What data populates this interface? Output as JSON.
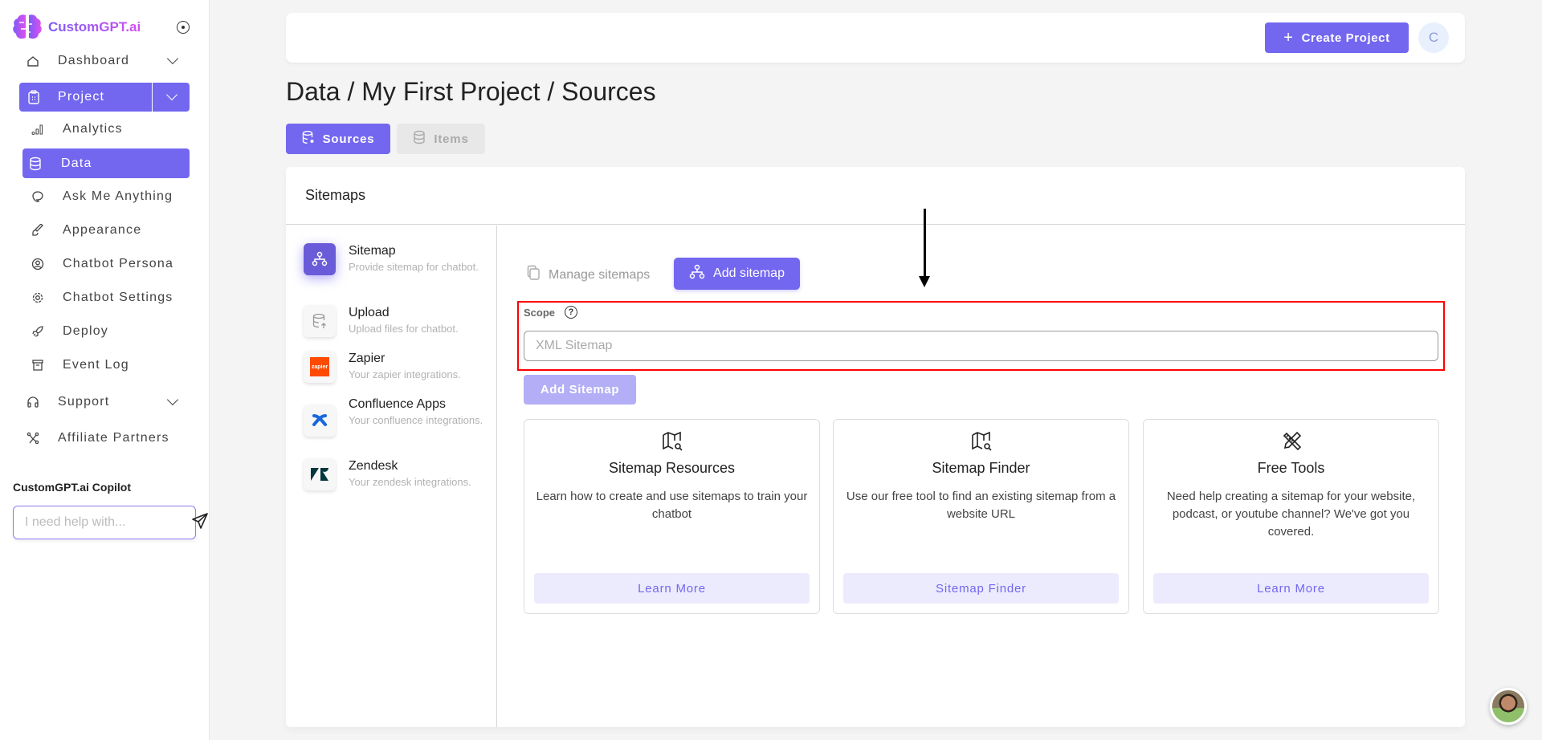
{
  "sidebar": {
    "brand": "CustomGPT.ai",
    "items": {
      "dashboard": "Dashboard",
      "project": "Project",
      "analytics": "Analytics",
      "data": "Data",
      "ask": "Ask Me Anything",
      "appearance": "Appearance",
      "persona": "Chatbot Persona",
      "settings": "Chatbot Settings",
      "deploy": "Deploy",
      "eventlog": "Event Log",
      "support": "Support",
      "affiliate": "Affiliate Partners"
    },
    "copilot": {
      "title": "CustomGPT.ai Copilot",
      "placeholder": "I need help with..."
    }
  },
  "header": {
    "create_project": "Create Project",
    "avatar_initial": "C"
  },
  "page": {
    "title": "Data / My First Project / Sources",
    "tabs": {
      "sources": "Sources",
      "items": "Items"
    }
  },
  "panel": {
    "title": "Sitemaps",
    "sources": [
      {
        "name": "Sitemap",
        "desc": "Provide sitemap for chatbot."
      },
      {
        "name": "Upload",
        "desc": "Upload files for chatbot."
      },
      {
        "name": "Zapier",
        "desc": "Your zapier integrations."
      },
      {
        "name": "Confluence Apps",
        "desc": "Your confluence integrations."
      },
      {
        "name": "Zendesk",
        "desc": "Your zendesk integrations."
      }
    ],
    "zapier_logo_text": "zapier",
    "manage_sitemaps": "Manage sitemaps",
    "add_sitemap_tab": "Add sitemap",
    "scope_label": "Scope",
    "help_glyph": "?",
    "input_placeholder": "XML Sitemap",
    "input_value": "",
    "add_sitemap_button": "Add Sitemap",
    "cards": [
      {
        "title": "Sitemap Resources",
        "desc": "Learn how to create and use sitemaps to train your chatbot",
        "button": "Learn More"
      },
      {
        "title": "Sitemap Finder",
        "desc": "Use our free tool to find an existing sitemap from a website URL",
        "button": "Sitemap Finder"
      },
      {
        "title": "Free Tools",
        "desc": "Need help creating a sitemap for your website, podcast, or youtube channel? We've got you covered.",
        "button": "Learn More"
      }
    ]
  },
  "colors": {
    "accent": "#7367f0",
    "annotation": "#ff0000"
  }
}
